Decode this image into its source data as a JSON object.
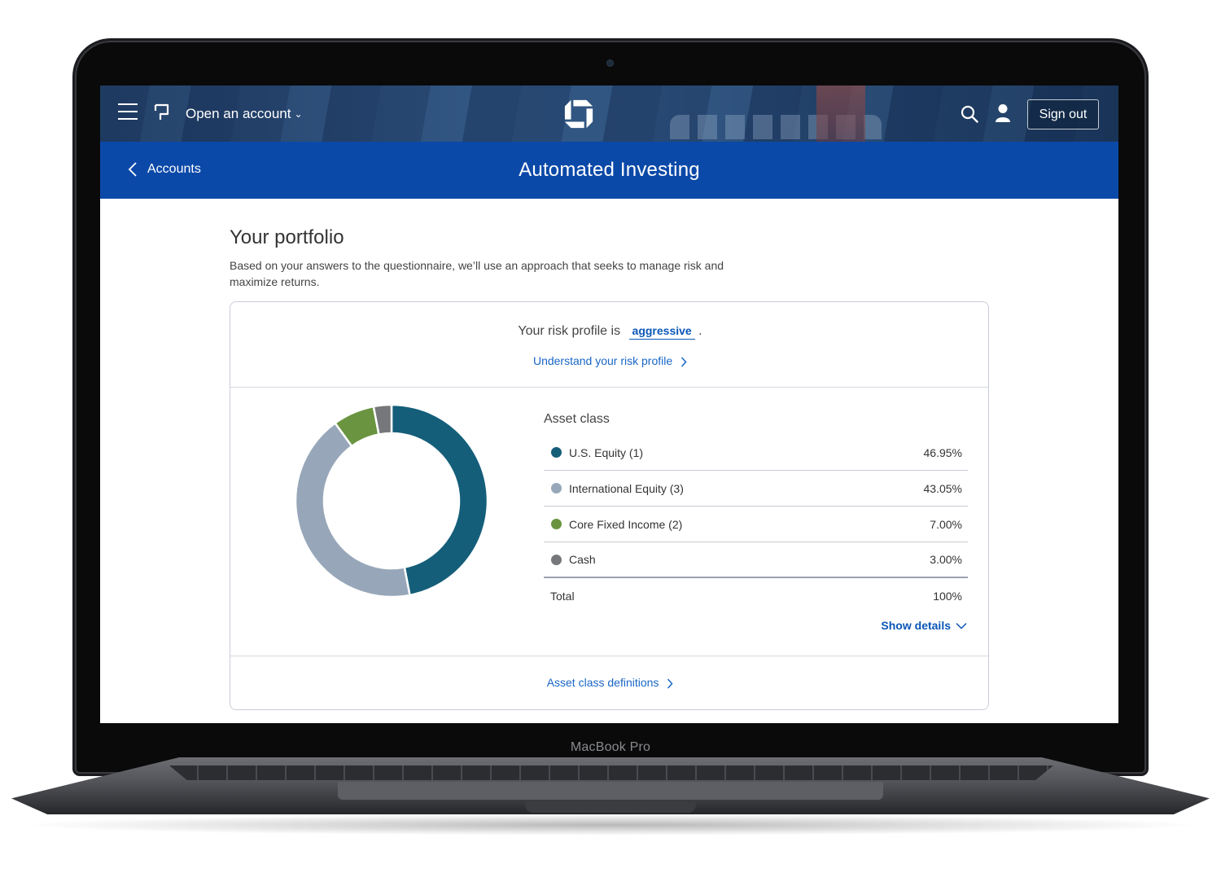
{
  "device": {
    "label": "MacBook Pro"
  },
  "header": {
    "open_account_label": "Open an account",
    "sign_out_label": "Sign out",
    "icons": [
      "menu-icon",
      "flag-icon",
      "chase-logo-icon",
      "search-icon",
      "user-icon"
    ]
  },
  "subheader": {
    "back_label": "Accounts",
    "title": "Automated Investing"
  },
  "portfolio": {
    "title": "Your portfolio",
    "intro": "Based on your answers to the questionnaire, we’ll use an approach that seeks to manage risk and maximize returns.",
    "risk_prefix": "Your risk profile is",
    "risk_value": "aggressive",
    "risk_suffix": ".",
    "risk_link": "Understand your risk profile",
    "asset_header": "Asset class",
    "assets": [
      {
        "name": "U.S. Equity (1)",
        "percent": "46.95%",
        "value": 46.95,
        "color": "#145e7a"
      },
      {
        "name": "International Equity (3)",
        "percent": "43.05%",
        "value": 43.05,
        "color": "#97a7b9"
      },
      {
        "name": "Core Fixed Income (2)",
        "percent": "7.00%",
        "value": 7.0,
        "color": "#6a9440"
      },
      {
        "name": "Cash",
        "percent": "3.00%",
        "value": 3.0,
        "color": "#76777a"
      }
    ],
    "total_label": "Total",
    "total_value": "100%",
    "show_details_label": "Show details",
    "definitions_link": "Asset class definitions"
  },
  "colors": {
    "header_blue": "#0b49a8",
    "link_blue": "#1866c7"
  }
}
